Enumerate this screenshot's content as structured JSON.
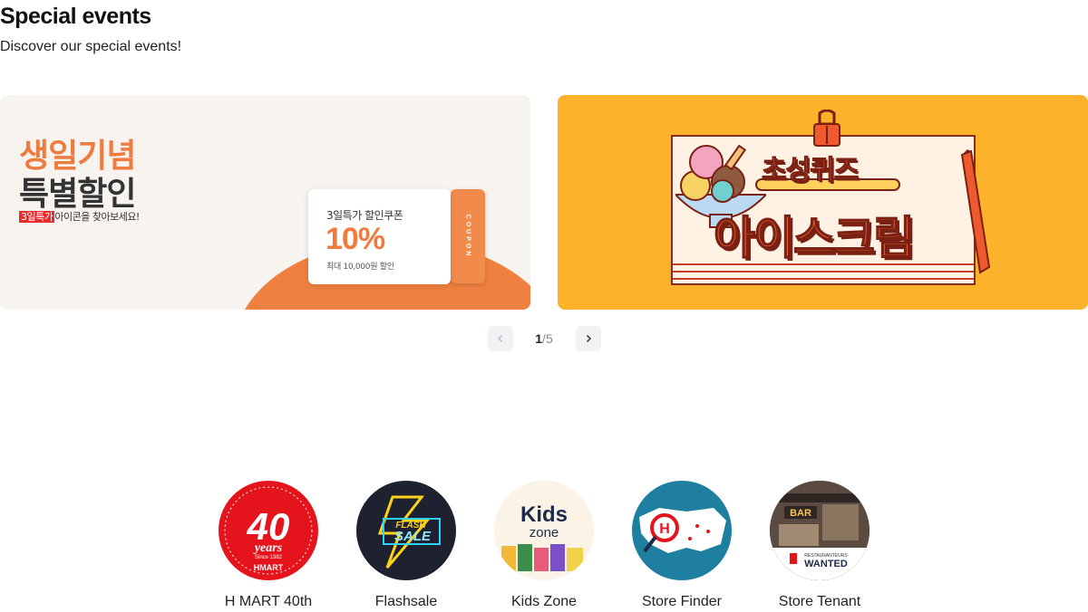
{
  "section": {
    "title": "Special events",
    "subtitle": "Discover our special events!"
  },
  "banners": [
    {
      "line1": "생일기념",
      "line2": "특별할인",
      "tag": "3일특가",
      "tagline_rest": "아이콘을 찾아보세요!",
      "coupon": {
        "title": "3일특가 할인쿠폰",
        "value": "10%",
        "note": "최대 10,000원 할인",
        "stub": "COUPON"
      },
      "colors": {
        "bg": "#f7f3ef",
        "accent": "#f07b3f"
      }
    },
    {
      "title": "초성퀴즈",
      "big": "아이스크림",
      "colors": {
        "bg": "#fdb22c",
        "accent": "#ee5a2e"
      }
    }
  ],
  "pager": {
    "current": "1",
    "separator": "/",
    "total": "5"
  },
  "shortcuts": [
    {
      "label": "H MART 40th",
      "icon": "hmart-40th-logo",
      "text_big": "40",
      "text_years": "years",
      "text_since": "Since 1982",
      "text_brand": "HMART"
    },
    {
      "label": "Flashsale",
      "icon": "flash-sale-neon",
      "text_top": "FLASH",
      "text_bottom": "SALE"
    },
    {
      "label": "Kids Zone",
      "icon": "kids-zone-thumbnail",
      "text_top": "Kids",
      "text_bottom": "zone"
    },
    {
      "label": "Store Finder",
      "icon": "store-finder-map",
      "text_mark": "H"
    },
    {
      "label": "Store Tenant",
      "icon": "store-tenant-photo",
      "text_bar": "BAR",
      "text_small": "RESTAURANTEURS",
      "text_big": "WANTED"
    }
  ]
}
